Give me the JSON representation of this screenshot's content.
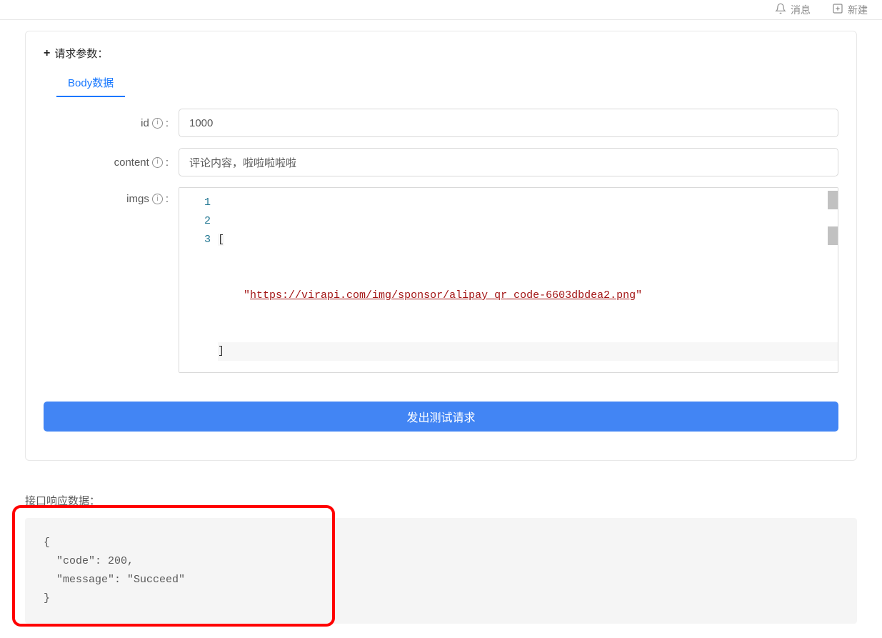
{
  "topnav": {
    "notifications": "消息",
    "new": "新建"
  },
  "request": {
    "section_title": "请求参数：",
    "plus": "+",
    "tabs": {
      "body": "Body数据"
    },
    "fields": {
      "id": {
        "label": "id",
        "value": "1000"
      },
      "content": {
        "label": "content",
        "value": "评论内容，啦啦啦啦啦"
      },
      "imgs": {
        "label": "imgs",
        "lines": [
          "1",
          "2",
          "3"
        ],
        "bracket_open": "[",
        "bracket_close": "]",
        "url_quote_open": "\"",
        "url": "https://virapi.com/img/sponsor/alipay_qr_code-6603dbdea2.png",
        "url_quote_close": "\""
      }
    },
    "submit": "发出测试请求"
  },
  "response": {
    "section_title": "接口响应数据：",
    "body": "{\n  \"code\": 200,\n  \"message\": \"Succeed\"\n}"
  }
}
